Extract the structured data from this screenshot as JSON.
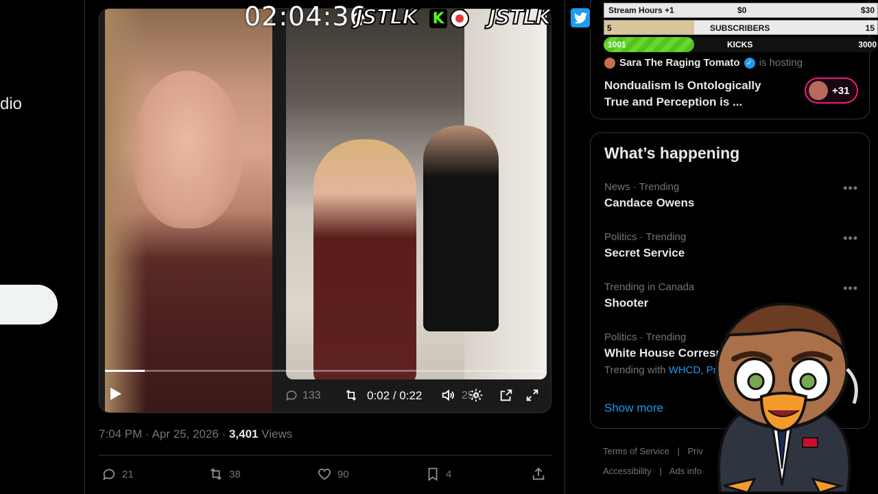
{
  "left_nav": {
    "partial_label": "dio"
  },
  "video": {
    "current_time": "0:02",
    "total_time": "0:22",
    "time_separator": "/",
    "progress_fraction": 0.09,
    "faded_reply_count": "133",
    "faded_like_count": "25K"
  },
  "tweet": {
    "timestamp": "7:04 PM · Apr 25, 2026 ·",
    "views_count": "3,401",
    "views_label": "Views",
    "replies": "21",
    "reposts": "38",
    "likes": "90",
    "bookmarks": "4"
  },
  "space": {
    "host_name": "Sara The Raging Tomato",
    "hosting_label": "is hosting",
    "title": "Nondualism Is Ontologically True and Perception is ...",
    "listener_count": "+31"
  },
  "trends": {
    "title": "What’s happening",
    "items": [
      {
        "context": "News · Trending",
        "topic": "Candace Owens"
      },
      {
        "context": "Politics · Trending",
        "topic": "Secret Service"
      },
      {
        "context": "Trending in Canada",
        "topic": "Shooter"
      },
      {
        "context": "Politics · Trending",
        "topic": "White House Corresp",
        "with_label": "Trending with",
        "with_tags": "WHCD, Pre"
      }
    ],
    "show_more": "Show more"
  },
  "footer": {
    "terms": "Terms of Service",
    "privacy": "Priv",
    "accessibility": "Accessibility",
    "ads_info": "Ads info"
  },
  "overlay": {
    "clock": "02:04:36",
    "logo_left": "JSTLK",
    "logo_right": "JSTLK",
    "kick_letter": "K",
    "stream_hours_label": "Stream Hours +1",
    "stream_hours_min": "$0",
    "stream_hours_max": "$30",
    "subs_current": "5",
    "subs_label": "SUBSCRIBERS",
    "subs_goal": "15",
    "subs_fraction": 0.33,
    "kicks_current": "1001",
    "kicks_label": "KICKS",
    "kicks_goal": "3000",
    "kicks_fraction": 0.33
  },
  "colors": {
    "accent_blue": "#1d9bf0",
    "kick_green": "#53fc18",
    "space_pink": "#f91880",
    "muted_text": "#71767b"
  }
}
